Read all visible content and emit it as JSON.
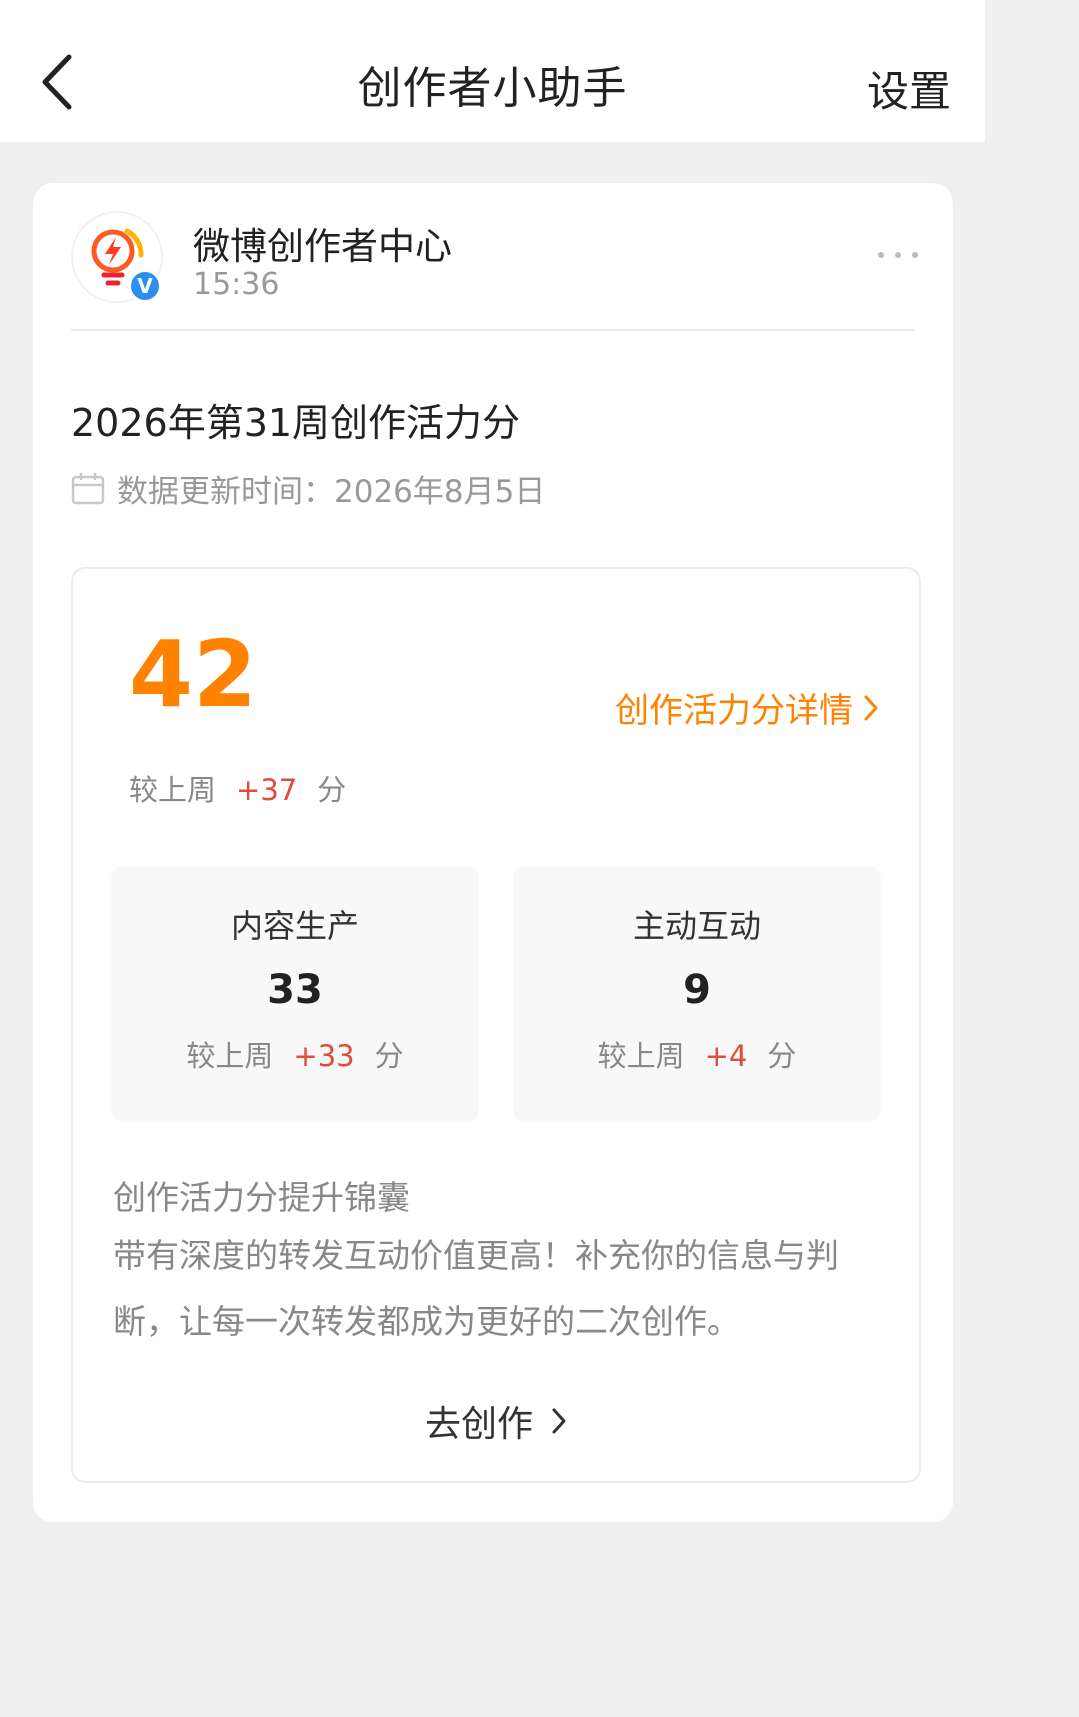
{
  "header": {
    "title": "创作者小助手",
    "settings_label": "设置"
  },
  "post": {
    "account_name": "微博创作者中心",
    "time": "15:36",
    "verified_badge": "V",
    "title": "2026年第31周创作活力分",
    "update_text": "数据更新时间：2026年8月5日"
  },
  "score": {
    "total": "42",
    "detail_link_label": "创作活力分详情",
    "compare_prefix": "较上周",
    "compare_delta": "+37",
    "compare_suffix": "分",
    "accent_color": "#ff8200",
    "delta_color": "#e04b3a"
  },
  "breakdown": [
    {
      "label": "内容生产",
      "value": "33",
      "compare_prefix": "较上周",
      "compare_delta": "+33",
      "compare_suffix": "分"
    },
    {
      "label": "主动互动",
      "value": "9",
      "compare_prefix": "较上周",
      "compare_delta": "+4",
      "compare_suffix": "分"
    }
  ],
  "tips": {
    "title": "创作活力分提升锦囊",
    "body": "带有深度的转发互动价值更高！补充你的信息与判断，让每一次转发都成为更好的二次创作。"
  },
  "cta": {
    "label": "去创作"
  },
  "icons": {
    "back": "back-chevron-icon",
    "logo": "lightbulb-bolt-logo-icon",
    "more": "more-dots-icon",
    "calendar": "calendar-icon",
    "chevron": "chevron-right-icon"
  }
}
